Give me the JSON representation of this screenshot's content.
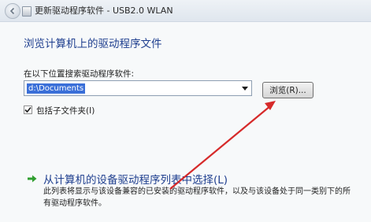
{
  "window": {
    "title": "更新驱动程序软件 - USB2.0 WLAN"
  },
  "page": {
    "heading": "浏览计算机上的驱动程序文件",
    "search_label": "在以下位置搜索驱动程序软件:",
    "path_value": "d:\\Documents",
    "browse_label": "浏览(R)...",
    "include_subfolders_label": "包括子文件夹(I)",
    "include_subfolders_checked": true,
    "pick_from_list_title": "从计算机的设备驱动程序列表中选择(L)",
    "pick_from_list_desc": "此列表将显示与该设备兼容的已安装的驱动程序软件，以及与该设备处于同一类别下的所有驱动程序软件。"
  },
  "icons": {
    "back": "back-arrow-icon",
    "device": "device-icon",
    "dropdown": "chevron-down-icon",
    "check": "checkmark-icon",
    "option_arrow": "green-arrow-icon"
  },
  "colors": {
    "heading": "#1f3f8f",
    "option_arrow": "#2f9e2f",
    "annotation_arrow": "#d62a2a",
    "selection": "#3a6fd8"
  }
}
